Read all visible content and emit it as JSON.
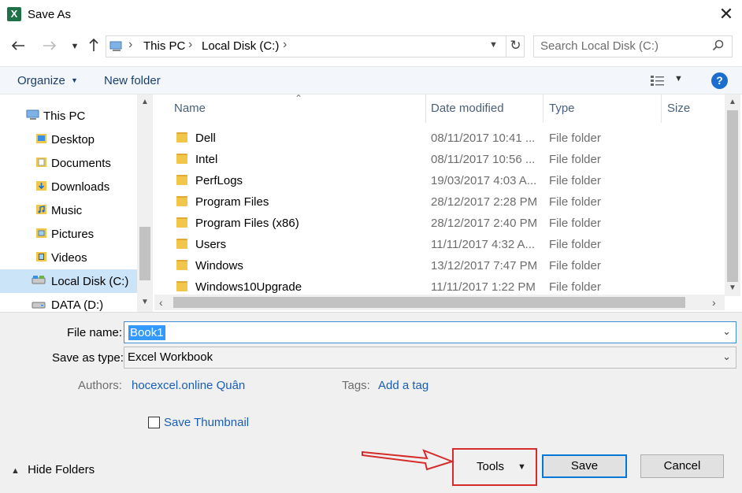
{
  "window": {
    "title": "Save As",
    "app_icon_letter": "X"
  },
  "navigation": {
    "back_icon": "arrow-left-icon",
    "forward_icon": "arrow-right-icon",
    "recent_icon": "chevron-down-icon",
    "up_icon": "arrow-up-icon",
    "breadcrumbs": [
      "This PC",
      "Local Disk (C:)"
    ],
    "search_placeholder": "Search Local Disk (C:)"
  },
  "toolbar": {
    "organize_label": "Organize",
    "new_folder_label": "New folder",
    "help_label": "?"
  },
  "sidebar": {
    "items": [
      {
        "label": "This PC",
        "icon": "computer-icon"
      },
      {
        "label": "Desktop",
        "icon": "desktop-folder-icon"
      },
      {
        "label": "Documents",
        "icon": "documents-folder-icon"
      },
      {
        "label": "Downloads",
        "icon": "downloads-folder-icon"
      },
      {
        "label": "Music",
        "icon": "music-folder-icon"
      },
      {
        "label": "Pictures",
        "icon": "pictures-folder-icon"
      },
      {
        "label": "Videos",
        "icon": "videos-folder-icon"
      },
      {
        "label": "Local Disk (C:)",
        "icon": "drive-icon",
        "selected": true
      },
      {
        "label": "DATA (D:)",
        "icon": "drive-icon"
      }
    ]
  },
  "file_list": {
    "columns": [
      "Name",
      "Date modified",
      "Type",
      "Size"
    ],
    "rows": [
      {
        "name": "Dell",
        "date": "08/11/2017 10:41 ...",
        "type": "File folder"
      },
      {
        "name": "Intel",
        "date": "08/11/2017 10:56 ...",
        "type": "File folder"
      },
      {
        "name": "PerfLogs",
        "date": "19/03/2017 4:03 A...",
        "type": "File folder"
      },
      {
        "name": "Program Files",
        "date": "28/12/2017 2:28 PM",
        "type": "File folder"
      },
      {
        "name": "Program Files (x86)",
        "date": "28/12/2017 2:40 PM",
        "type": "File folder"
      },
      {
        "name": "Users",
        "date": "11/11/2017 4:32 A...",
        "type": "File folder"
      },
      {
        "name": "Windows",
        "date": "13/12/2017 7:47 PM",
        "type": "File folder"
      },
      {
        "name": "Windows10Upgrade",
        "date": "11/11/2017 1:22 PM",
        "type": "File folder"
      }
    ]
  },
  "form": {
    "file_name_label": "File name:",
    "file_name_value": "Book1",
    "save_type_label": "Save as type:",
    "save_type_value": "Excel Workbook",
    "authors_label": "Authors:",
    "authors_value": "hocexcel.online Quân",
    "tags_label": "Tags:",
    "tags_value": "Add a tag",
    "save_thumbnail_label": "Save Thumbnail"
  },
  "footer": {
    "hide_folders_label": "Hide Folders",
    "tools_label": "Tools",
    "save_label": "Save",
    "cancel_label": "Cancel"
  },
  "colors": {
    "accent": "#0078d7",
    "selection": "#cce4f7",
    "highlight_box": "#d62b2b",
    "excel_green": "#1e7145"
  }
}
